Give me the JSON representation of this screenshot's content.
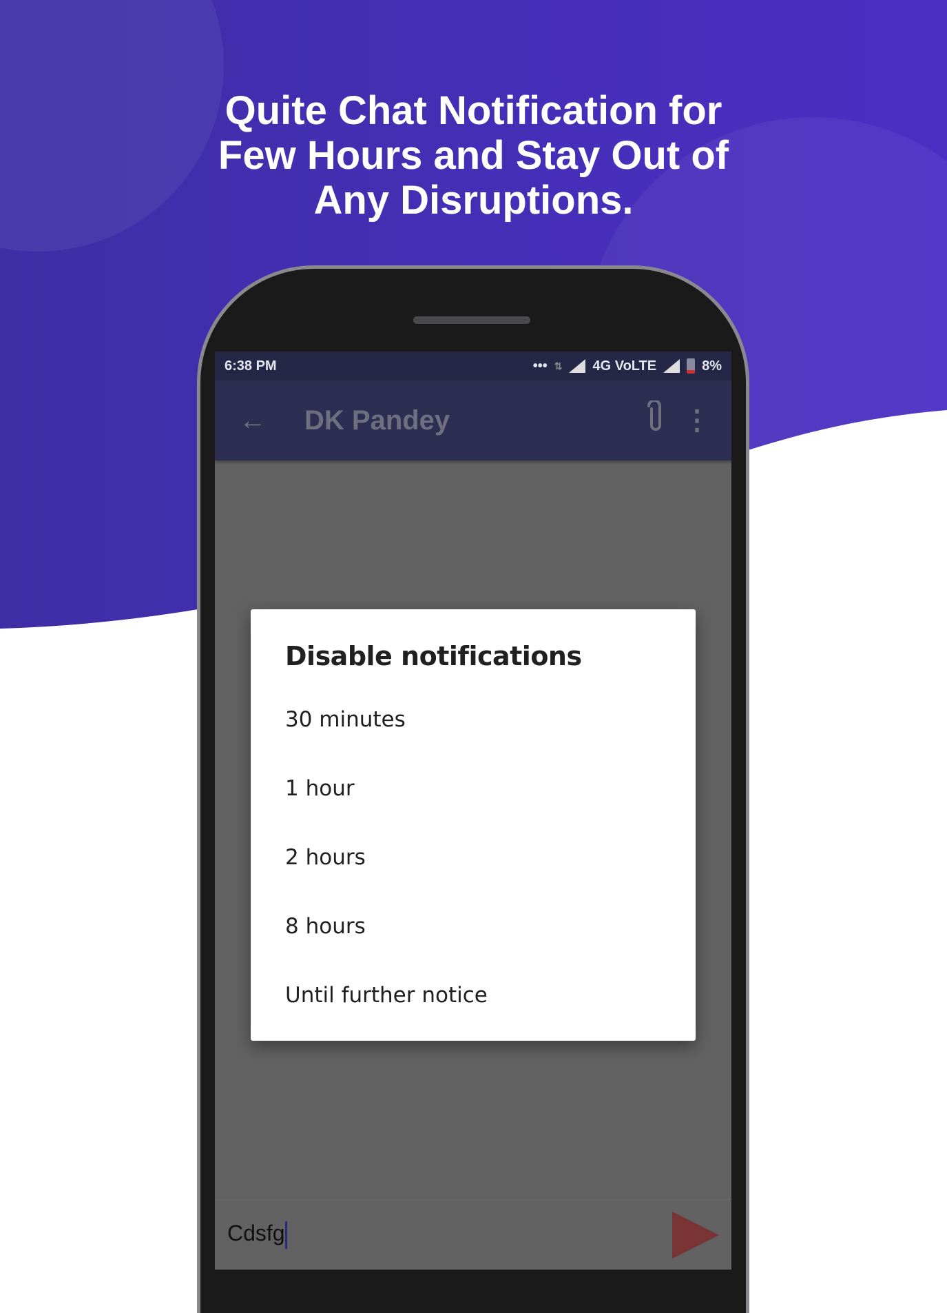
{
  "headline": [
    "Quite Chat Notification for",
    "Few Hours and Stay Out of",
    "Any Disruptions."
  ],
  "colors": {
    "background": "#4530bb",
    "app_bar": "#2e2e52",
    "send": "#7a3434"
  },
  "status_bar": {
    "time": "6:38 PM",
    "dots": "•••",
    "network": "4G VoLTE",
    "battery": "8%"
  },
  "app_bar": {
    "back_icon": "arrow-left",
    "title": "DK Pandey",
    "attach_icon": "paperclip",
    "more_icon": "vertical-dots"
  },
  "dialog": {
    "title": "Disable notifications",
    "options": [
      "30 minutes",
      "1 hour",
      "2 hours",
      "8 hours",
      "Until further notice"
    ]
  },
  "composer": {
    "value": "Cdsfg",
    "send_icon": "send-arrow"
  }
}
